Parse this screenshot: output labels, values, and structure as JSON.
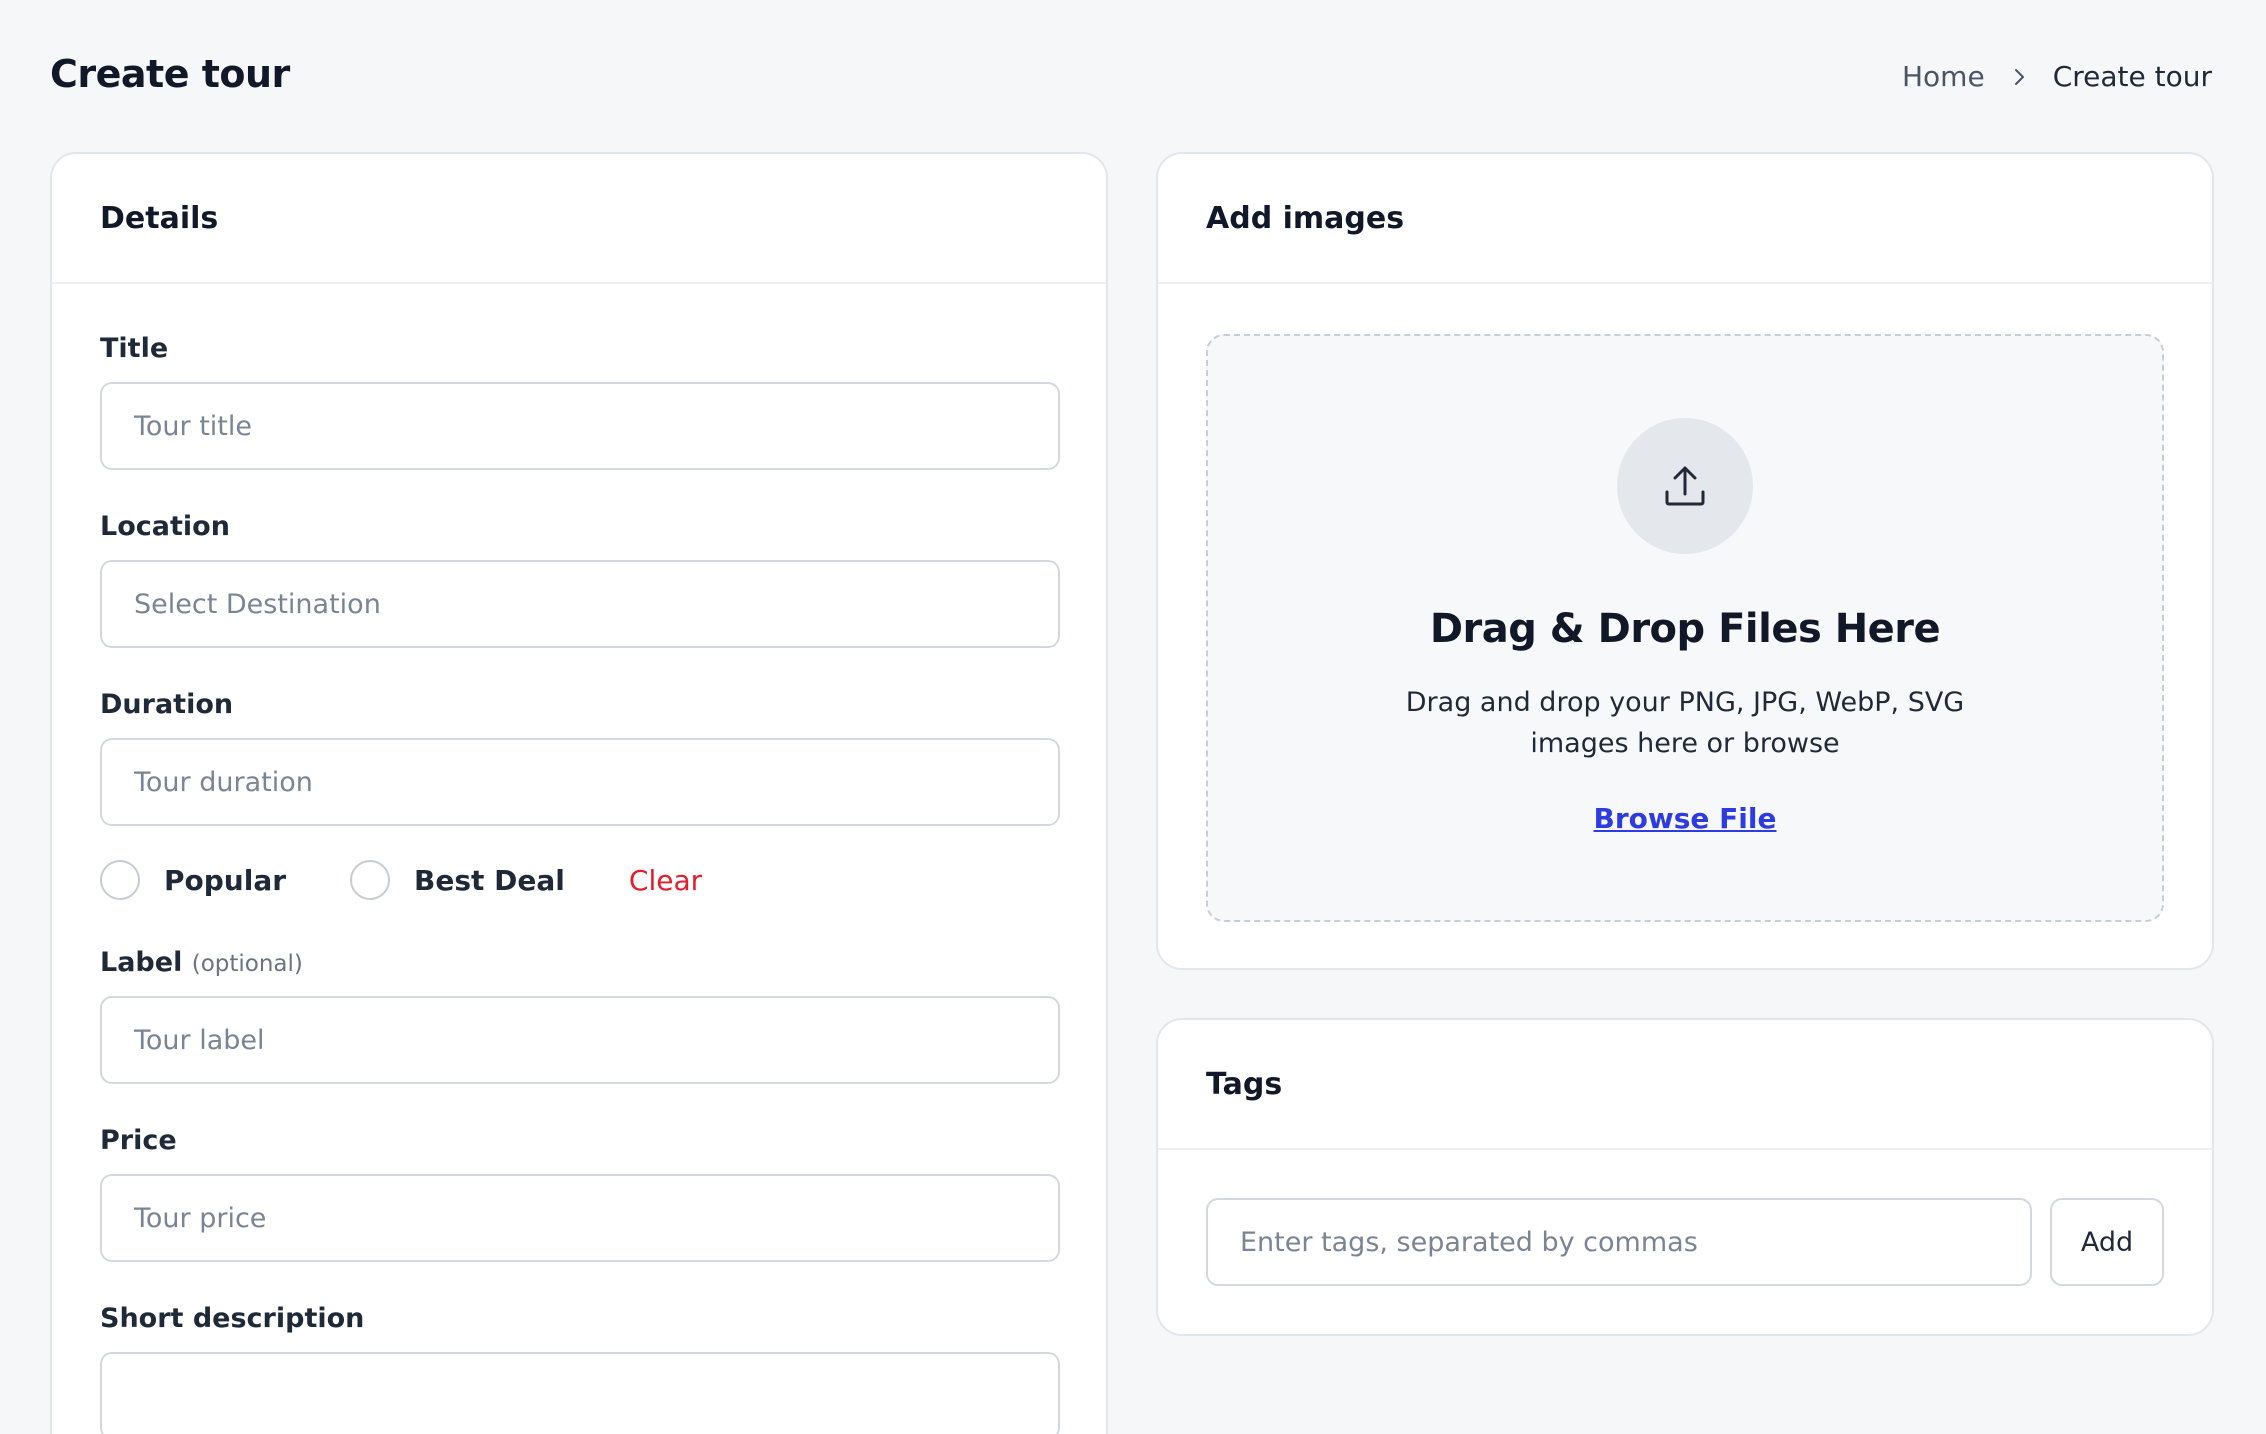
{
  "page": {
    "title": "Create tour"
  },
  "breadcrumb": {
    "home": "Home",
    "current": "Create tour"
  },
  "details": {
    "header": "Details",
    "title_field": {
      "label": "Title",
      "placeholder": "Tour title",
      "value": ""
    },
    "location_field": {
      "label": "Location",
      "placeholder": "Select Destination",
      "value": ""
    },
    "duration_field": {
      "label": "Duration",
      "placeholder": "Tour duration",
      "value": ""
    },
    "radios": {
      "popular": "Popular",
      "best_deal": "Best Deal",
      "clear": "Clear"
    },
    "label_field": {
      "label": "Label",
      "optional": "(optional)",
      "placeholder": "Tour label",
      "value": ""
    },
    "price_field": {
      "label": "Price",
      "placeholder": "Tour price",
      "value": ""
    },
    "short_description": {
      "label": "Short description"
    }
  },
  "images": {
    "header": "Add images",
    "icon": "upload-icon",
    "drop_title": "Drag & Drop Files Here",
    "drop_desc": "Drag and drop your PNG, JPG, WebP, SVG images here or browse",
    "browse_label": "Browse File"
  },
  "tags": {
    "header": "Tags",
    "placeholder": "Enter tags, separated by commas",
    "add_label": "Add"
  },
  "colors": {
    "background": "#f6f7f9",
    "clear": "#e11d2e",
    "browse_link": "#2d3be0",
    "upload_circle": "#e4e7ec"
  }
}
